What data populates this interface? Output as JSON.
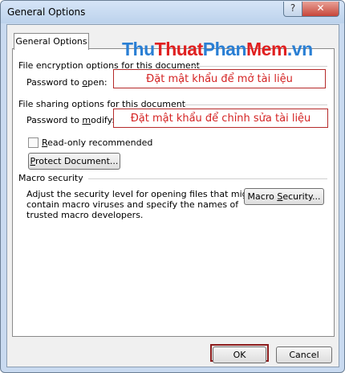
{
  "window": {
    "title": "General Options",
    "help_label": "?",
    "close_label": "✕"
  },
  "watermark": {
    "part1": "Thu",
    "part2": "Thuat",
    "part3": "Phan",
    "part4": "Mem",
    "part5": ".vn"
  },
  "tab": {
    "label": "General Options"
  },
  "encryption": {
    "heading": "File encryption options for this document",
    "password_label_pre": "Password to ",
    "password_label_key": "o",
    "password_label_post": "pen:",
    "password_value": "Đặt mật khẩu để mở tài liệu"
  },
  "sharing": {
    "heading": "File sharing options for this document",
    "password_label_pre": "Password to ",
    "password_label_key": "m",
    "password_label_post": "odify:",
    "password_value": "Đặt mật khẩu để chỉnh sửa tài liệu",
    "readonly_key": "R",
    "readonly_rest": "ead-only recommended",
    "readonly_checked": false,
    "protect_key": "P",
    "protect_rest": "rotect Document..."
  },
  "macro": {
    "heading": "Macro security",
    "description_line1": "Adjust the security level for opening files that might",
    "description_line2": "contain macro viruses and specify the names of",
    "description_line3": "trusted macro developers.",
    "button_pre": "Macro ",
    "button_key": "S",
    "button_post": "ecurity..."
  },
  "footer": {
    "ok_label": "OK",
    "cancel_label": "Cancel"
  },
  "colors": {
    "accent_red": "#d42323",
    "logo_blue": "#2a7fd4",
    "logo_red": "#e02020"
  }
}
